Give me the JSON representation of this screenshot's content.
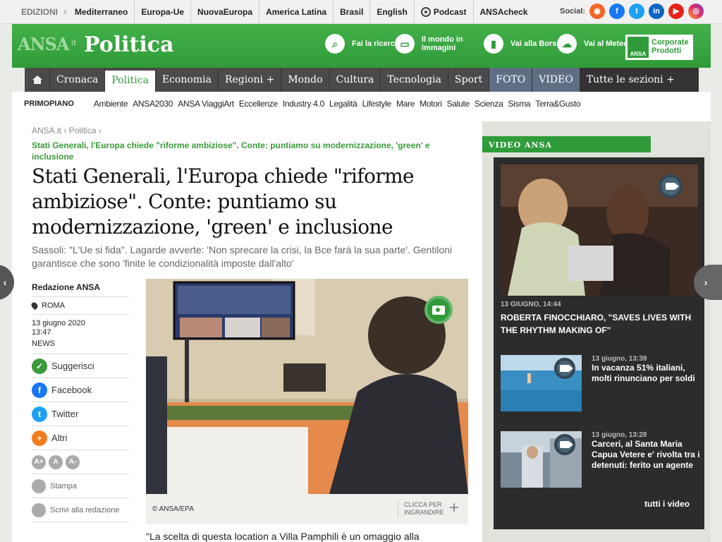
{
  "topbar": {
    "editions_label": "EDIZIONI",
    "editions": [
      "Mediterraneo",
      "Europa-Ue",
      "NuovaEuropa",
      "America Latina",
      "Brasil",
      "English",
      "Podcast",
      "ANSAcheck"
    ],
    "social_label": "Social:",
    "social_icons": [
      "rss-icon",
      "facebook-icon",
      "twitter-icon",
      "linkedin-icon",
      "youtube-icon",
      "instagram-icon"
    ]
  },
  "header": {
    "logo": "ANSA",
    "logo_suffix": "it",
    "section": "Politica",
    "buttons": [
      {
        "label": "Fai la ricerca",
        "icon": "search-icon"
      },
      {
        "label": "Il mondo in immagini",
        "icon": "screen-icon"
      },
      {
        "label": "Vai alla Borsa",
        "icon": "chart-icon"
      },
      {
        "label": "Vai al Meteo",
        "icon": "weather-icon"
      }
    ],
    "corporate_badge": "ANSA",
    "corporate_label": "Corporate Prodotti"
  },
  "nav": {
    "items": [
      "Cronaca",
      "Politica",
      "Economia",
      "Regioni +",
      "Mondo",
      "Cultura",
      "Tecnologia",
      "Sport",
      "FOTO",
      "VIDEO",
      "Tutte le sezioni +"
    ],
    "active": "Politica"
  },
  "subnav": {
    "primary": "PRIMOPIANO",
    "items": [
      "Ambiente",
      "ANSA2030",
      "ANSA ViaggiArt",
      "Eccellenze",
      "Industry 4.0",
      "Legalità",
      "Lifestyle",
      "Mare",
      "Motori",
      "Salute",
      "Scienza",
      "Sisma",
      "Terra&Gusto"
    ]
  },
  "article": {
    "breadcrumb": [
      "ANSA.it",
      "Politica"
    ],
    "kicker": "Stati Generali, l'Europa chiede \"riforme ambiziose\". Conte: puntiamo su modernizzazione, 'green' e inclusione",
    "title": "Stati Generali, l'Europa chiede \"riforme ambiziose\". Conte: puntiamo su modernizzazione, 'green' e inclusione",
    "subtitle": "Sassoli: \"L'Ue si fida\". Lagarde avverte: 'Non sprecare la crisi, la Bce farà la sua parte'. Gentiloni garantisce che sono 'finite le condizionalità imposte dall'alto'",
    "author": "Redazione ANSA",
    "location": "ROMA",
    "date": "13 giugno 2020",
    "time": "13:47",
    "type": "NEWS",
    "actions": [
      "Suggerisci",
      "Facebook",
      "Twitter",
      "Altri"
    ],
    "font_sizes": [
      "A+",
      "A",
      "A-"
    ],
    "print": "Stampa",
    "write": "Scrivi alla redazione",
    "photo_credit": "© ANSA/EPA",
    "enlarge": "CLICCA PER INGRANDIRE",
    "body_start": "\"La scelta di questa location a Villa Pamphili è un omaggio alla"
  },
  "video": {
    "header": "VIDEO ANSA",
    "main": {
      "date": "13 GIUGNO, 14:44",
      "title": "ROBERTA FINOCCHIARO, \"SAVES LIVES WITH THE RHYTHM MAKING OF\""
    },
    "items": [
      {
        "date": "13 giugno, 13:39",
        "title": "In vacanza 51% italiani, molti rinunciano per soldi"
      },
      {
        "date": "13 giugno, 13:28",
        "title": "Carceri, al Santa Maria Capua Vetere e' rivolta tra i detenuti: ferito un agente"
      }
    ],
    "all": "tutti i video"
  },
  "colors": {
    "brand_green": "#2f9c39",
    "nav_dark": "#4a4a4a",
    "media_tab": "#5e6e85"
  }
}
